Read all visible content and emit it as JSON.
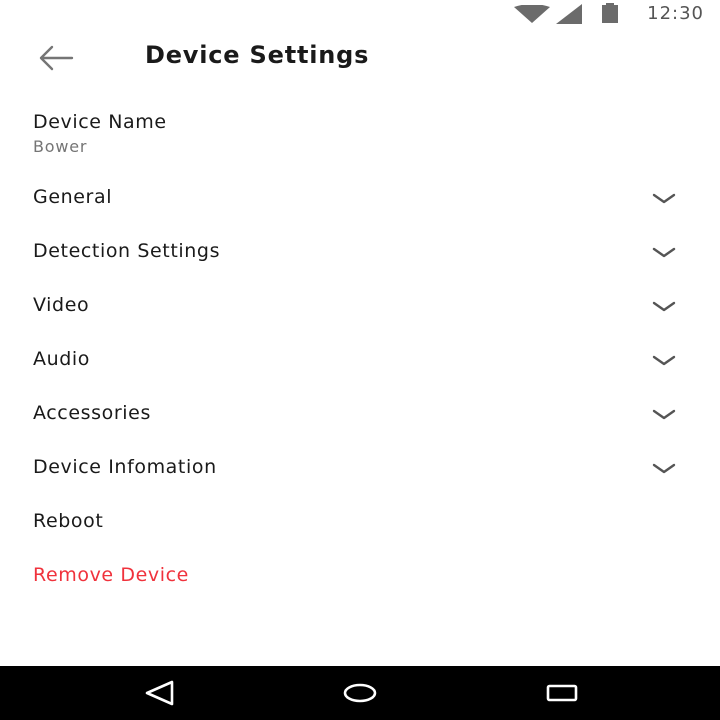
{
  "status_bar": {
    "time": "12:30",
    "icons": [
      "wifi-icon",
      "cellular-signal-icon",
      "battery-icon"
    ]
  },
  "header": {
    "title": "Device Settings",
    "back_icon": "arrow-left-icon"
  },
  "device_name": {
    "label": "Device Name",
    "value": "Bower"
  },
  "menu": {
    "items": [
      {
        "label": "General",
        "expandable": true
      },
      {
        "label": "Detection Settings",
        "expandable": true
      },
      {
        "label": "Video",
        "expandable": true
      },
      {
        "label": "Audio",
        "expandable": true
      },
      {
        "label": "Accessories",
        "expandable": true
      },
      {
        "label": "Device Infomation",
        "expandable": true
      },
      {
        "label": "Reboot",
        "expandable": false
      },
      {
        "label": "Remove Device",
        "expandable": false
      }
    ]
  },
  "colors": {
    "danger": "#f0323c",
    "secondary_text": "#757575",
    "nav_bar": "#000000"
  },
  "nav_bar": {
    "icons": [
      "back-triangle-icon",
      "home-circle-icon",
      "recents-square-icon"
    ]
  }
}
